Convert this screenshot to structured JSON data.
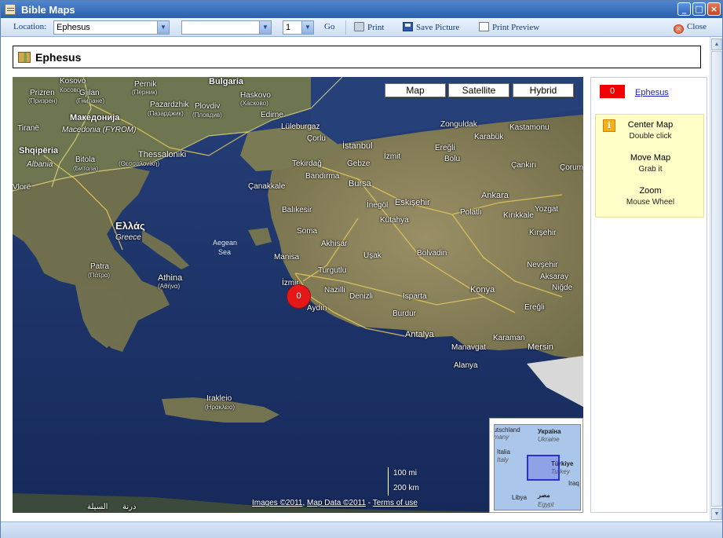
{
  "window": {
    "title": "Bible Maps"
  },
  "toolbar": {
    "location_label": "Location:",
    "location_value": "Ephesus",
    "sub_value": "",
    "page_value": "1",
    "go_label": "Go",
    "print_label": "Print",
    "save_label": "Save Picture",
    "preview_label": "Print Preview",
    "close_label": "Close"
  },
  "heading": {
    "title": "Ephesus"
  },
  "map": {
    "types": [
      "Map",
      "Satellite",
      "Hybrid"
    ],
    "marker_label": "0",
    "scale_mi": "100 mi",
    "scale_km": "200 km",
    "copyright": {
      "images": "Images ©2011",
      "sep1": ", ",
      "mapdata": "Map Data ©2011",
      "sep2": " - ",
      "terms": "Terms of use"
    },
    "labels": {
      "kosovo": "Kosovo",
      "kosovo_sub": "Косово",
      "pernik": "Pernik",
      "pernik_sub": "(Перник)",
      "bulgaria": "Bulgaria",
      "haskovo": "Haskovo",
      "haskovo_sub": "(Хасково)",
      "prizren": "Prizren",
      "prizren_sub": "(Призрен)",
      "gjilan": "Gjilan",
      "gjilan_sub": "(Гнилане)",
      "pazardzhik": "Pazardzhik",
      "pazardzhik_sub": "(Пазарджик)",
      "plovdiv": "Plovdiv",
      "plovdiv_sub": "(Пловдив)",
      "edirne": "Edirne",
      "luleburgaz": "Lüleburgaz",
      "corlu": "Çorlu",
      "zonguldak": "Zonguldak",
      "kastamonu": "Kastamonu",
      "tirane": "Tiranë",
      "makedonija": "Македонија",
      "macedonia": "Macedonia (FYROM)",
      "istanbul": "İstanbul",
      "eregli_n": "Ereğli",
      "karabuk": "Karabük",
      "shqiperia": "Shqipëria",
      "albania": "Albania",
      "bitola": "Bitola",
      "bitola_sub": "(Битола)",
      "thessaloniki": "Thessaloniki",
      "thessaloniki_sub": "(Θεσσαλονίκη)",
      "tekirdag": "Tekirdağ",
      "gebze": "Gebze",
      "izmit": "İzmit",
      "bolu": "Bolu",
      "cankiri": "Çankırı",
      "corum": "Çorum",
      "vlore": "Vlorë",
      "bandirma": "Bandırma",
      "canakkale": "Çanakkale",
      "bursa": "Bursa",
      "inegol": "İnegöl",
      "eskisehir": "Eskişehir",
      "ankara": "Ankara",
      "kirikkale": "Kırıkkale",
      "yozgat": "Yozgat",
      "balikesir": "Balıkesir",
      "polatli": "Polatlı",
      "kutahya": "Kütahya",
      "kirsehir": "Kırşehir",
      "ellas": "Ελλάς",
      "greece": "Greece",
      "soma": "Soma",
      "akhisar": "Akhisar",
      "aegean": "Aegean",
      "sea": "Sea",
      "manisa": "Manisa",
      "turgutlu": "Turgutlu",
      "usak": "Uşak",
      "bolvadin": "Bolvadin",
      "nevsehir": "Nevşehir",
      "aksaray": "Aksaray",
      "nigde": "Niğde",
      "patra": "Patra",
      "patra_sub": "(Πάτρα)",
      "athina": "Athina",
      "athina_sub": "(Αθήνα)",
      "izmir": "İzmir",
      "nazilli": "Nazilli",
      "denizli": "Denizli",
      "isparta": "Isparta",
      "konya": "Konya",
      "aydin": "Aydın",
      "burdur": "Burdur",
      "eregli_s": "Ereğli",
      "antalya": "Antalya",
      "karaman": "Karaman",
      "manavgat": "Manavgat",
      "mersin": "Mersin",
      "alanya": "Alanya",
      "irakleio": "Irakleio",
      "irakleio_sub": "(Ηράκλειο)",
      "bottom_left": "السيلة",
      "bottom_left2": "درنة"
    },
    "overview": {
      "deutschland": "eutschland",
      "germany": "rmany",
      "ukraina": "Україна",
      "ukraine": "Ukraine",
      "italia": "Italia",
      "italy": "Italy",
      "turkiye": "Türkiye",
      "turkey": "Turkey",
      "libya": "Libya",
      "misr": "مصر",
      "egypt": "Egypt",
      "iraq": "Iraq"
    }
  },
  "side": {
    "badge": "0",
    "link": "Ephesus",
    "help": [
      {
        "title": "Center Map",
        "sub": "Double click"
      },
      {
        "title": "Move Map",
        "sub": "Grab it"
      },
      {
        "title": "Zoom",
        "sub": "Mouse Wheel"
      }
    ],
    "info_icon": "i"
  },
  "colors": {
    "marker": "#e41818",
    "badge": "#f00000",
    "help_bg": "#ffffc8",
    "titlebar": "#2b5fae"
  }
}
